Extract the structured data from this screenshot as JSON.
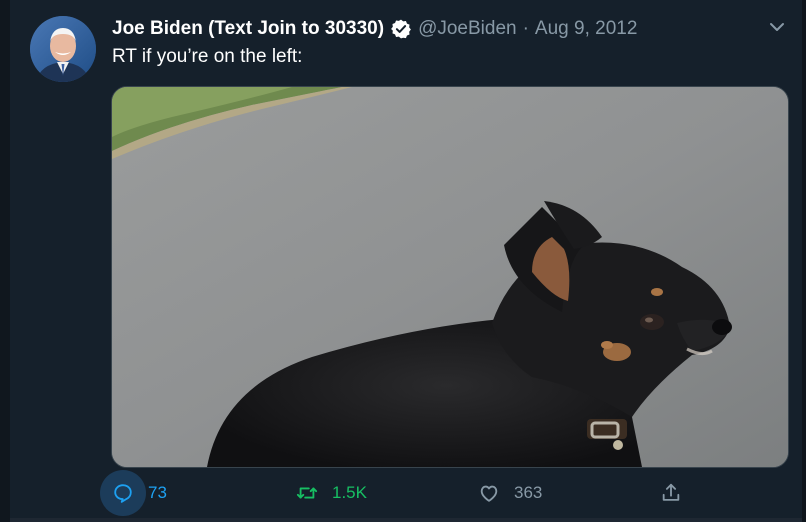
{
  "tweet": {
    "author_name": "Joe Biden (Text Join to 30330)",
    "handle": "@JoeBiden",
    "separator": "·",
    "date": "Aug 9, 2012",
    "text": "RT if you’re on the left:",
    "verified": true,
    "media_subject": "chihuahua-photo"
  },
  "actions": {
    "reply": {
      "icon": "reply-icon",
      "count": "73"
    },
    "retweet": {
      "icon": "retweet-icon",
      "count": "1.5K"
    },
    "like": {
      "icon": "heart-icon",
      "count": "363"
    },
    "share": {
      "icon": "share-icon"
    }
  },
  "colors": {
    "background": "#15202b",
    "accent_blue": "#1da1f2",
    "retweet_green": "#17bf63",
    "muted": "#8899a6"
  }
}
